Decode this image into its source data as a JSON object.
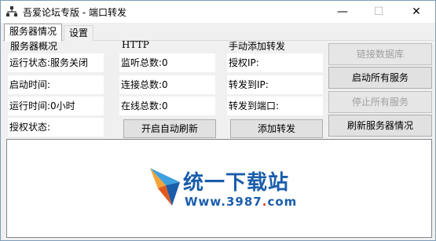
{
  "window": {
    "title": "吾爱论坛专版 - 端口转发",
    "minimize_glyph": "—",
    "maximize_glyph": "☐",
    "close_glyph": "✕"
  },
  "tabs": [
    {
      "label": "服务器情况",
      "active": true
    },
    {
      "label": "设置",
      "active": false
    }
  ],
  "server_overview": {
    "title": "服务器概况",
    "run_status": "运行状态:服务关闭",
    "start_time": "启动时间:",
    "run_time": "运行时间:0小时",
    "auth_status": "授权状态:"
  },
  "http": {
    "title": "HTTP",
    "listen_total": "监听总数:0",
    "conn_total": "连接总数:0",
    "online_total": "在线总数:0",
    "auto_refresh_button": "开启自动刷新"
  },
  "manual_forward": {
    "title": "手动添加转发",
    "auth_ip": "授权IP:",
    "forward_ip": "转发到IP:",
    "forward_port": "转发到端口:",
    "add_button": "添加转发"
  },
  "actions": {
    "connect_db": "链接数据库",
    "start_all": "启动所有服务",
    "stop_all": "停止所有服务",
    "refresh_info": "刷新服务器情况"
  },
  "watermark": {
    "name": "统一下载站",
    "url_prefix": "Www.3987",
    "url_dot": ".",
    "url_suffix": "com"
  }
}
